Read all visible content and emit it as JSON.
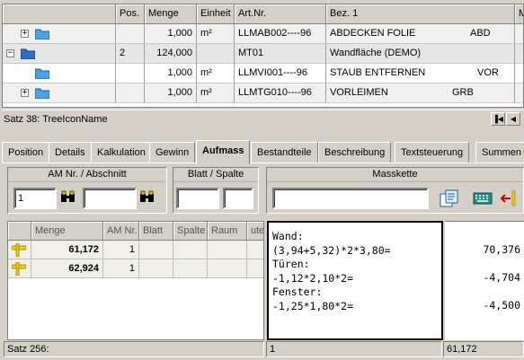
{
  "tree_grid": {
    "headers": [
      "Pos.",
      "Menge",
      "Einheit",
      "Art.Nr.",
      "Bez. 1",
      "M"
    ],
    "rows": [
      {
        "pos": "",
        "menge": "1,000",
        "einheit": "m²",
        "artnr": "LLMAB002----96",
        "bez": "ABDECKEN FOLIE",
        "code": "ABD",
        "expander": "+"
      },
      {
        "pos": "2",
        "menge": "124,000",
        "einheit": "",
        "artnr": "MT01",
        "bez": "Wandfläche (DEMO)",
        "code": "",
        "expander": "−"
      },
      {
        "pos": "",
        "menge": "1,000",
        "einheit": "m²",
        "artnr": "LLMVI001----96",
        "bez": "STAUB ENTFERNEN",
        "code": "VOR",
        "expander": ""
      },
      {
        "pos": "",
        "menge": "1,000",
        "einheit": "m²",
        "artnr": "LLMTG010----96",
        "bez": "VORLEIMEN",
        "code": "GRB",
        "expander": "+"
      }
    ],
    "status": "Satz 38: TreeIconName"
  },
  "tabs": [
    "Position",
    "Details",
    "Kalkulation",
    "Gewinn",
    "Aufmass",
    "Bestandteile",
    "Beschreibung",
    "Textsteuerung",
    "Summen"
  ],
  "active_tab": "Aufmass",
  "groups": {
    "am_nr_title": "AM Nr. / Abschnitt",
    "am_nr_value": "1",
    "abschnitt_value": "",
    "blatt_title": "Blatt / Spalte",
    "masskette_title": "Masskette"
  },
  "aufmass_grid": {
    "headers": [
      "",
      "Menge",
      "AM Nr.",
      "Blatt",
      "Spalte",
      "Raum",
      "utei"
    ],
    "rows": [
      {
        "menge": "61,172",
        "am_nr": "1"
      },
      {
        "menge": "62,924",
        "am_nr": "1"
      }
    ],
    "status": "Satz 256:"
  },
  "masskette": {
    "lines": [
      "Wand:",
      "(3,94+5,32)*2*3,80=",
      "Türen:",
      "-1,12*2,10*2=",
      "Fenster:",
      "-1,25*1,80*2="
    ],
    "results": [
      "",
      "70,376",
      "",
      "-4,704",
      "",
      "-4,500"
    ],
    "status_line": "1",
    "status_total": "61,172"
  },
  "colors": {
    "window_bg": "#d4d0c8",
    "folder_blue": "#4aa3e0",
    "marker_yellow": "#f0d000"
  }
}
